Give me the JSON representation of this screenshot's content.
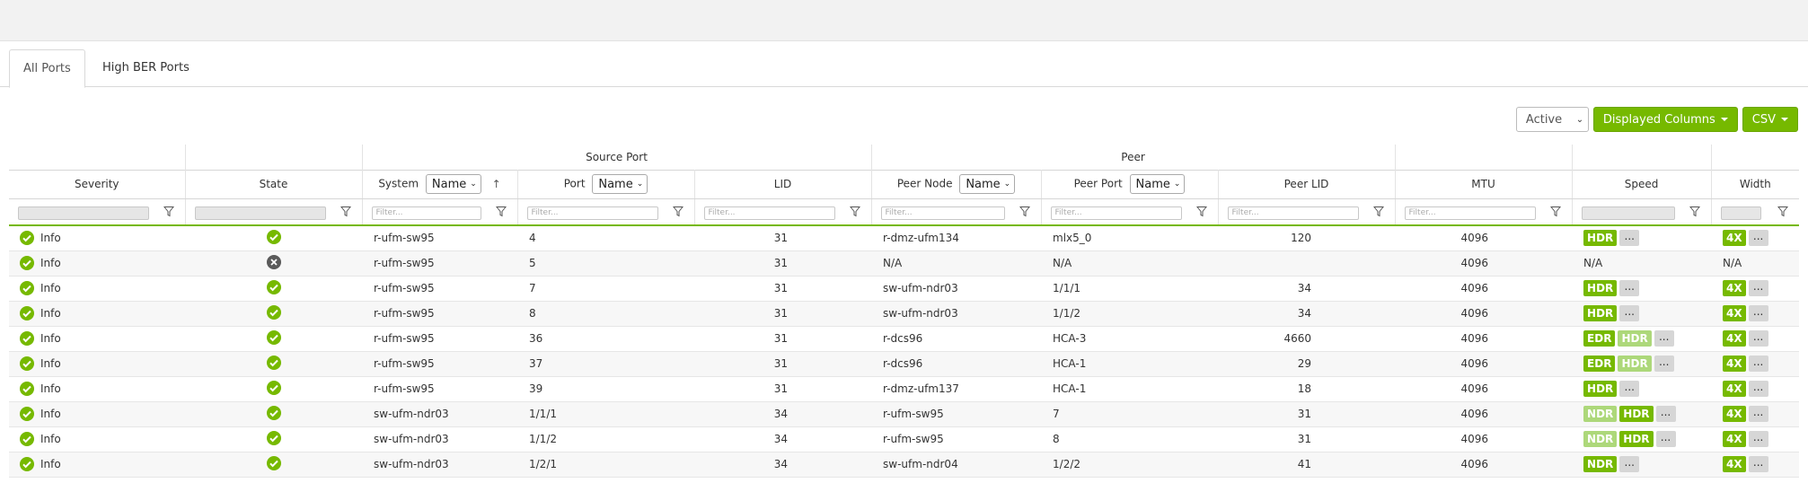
{
  "tabs": [
    {
      "label": "All Ports",
      "active": true
    },
    {
      "label": "High BER Ports",
      "active": false
    }
  ],
  "toolbar": {
    "state_select": "Active",
    "displayed_columns": "Displayed Columns",
    "csv": "CSV"
  },
  "groups": {
    "source_port": "Source Port",
    "peer": "Peer"
  },
  "columns": {
    "severity": "Severity",
    "state": "State",
    "system": "System",
    "system_select": "Name",
    "port": "Port",
    "port_select": "Name",
    "lid": "LID",
    "peer_node": "Peer Node",
    "peer_node_select": "Name",
    "peer_port": "Peer Port",
    "peer_port_select": "Name",
    "peer_lid": "Peer LID",
    "mtu": "MTU",
    "speed": "Speed",
    "width": "Width"
  },
  "filter_placeholder": "Filter...",
  "more_label": "...",
  "colors": {
    "accent": "#76b900",
    "accent_light": "#add87a",
    "state_error": "#5a5a5a"
  },
  "rows": [
    {
      "severity": "Info",
      "state": "ok",
      "system": "r-ufm-sw95",
      "port": "4",
      "lid": "31",
      "peer_node": "r-dmz-ufm134",
      "peer_port": "mlx5_0",
      "peer_lid": "120",
      "mtu": "4096",
      "speed": [
        {
          "label": "HDR",
          "tone": "dark"
        }
      ],
      "speed_more": true,
      "width": [
        {
          "label": "4X",
          "tone": "dark"
        }
      ],
      "width_more": true
    },
    {
      "severity": "Info",
      "state": "error",
      "system": "r-ufm-sw95",
      "port": "5",
      "lid": "31",
      "peer_node": "N/A",
      "peer_port": "N/A",
      "peer_lid": "",
      "mtu": "4096",
      "speed_text": "N/A",
      "width_text": "N/A"
    },
    {
      "severity": "Info",
      "state": "ok",
      "system": "r-ufm-sw95",
      "port": "7",
      "lid": "31",
      "peer_node": "sw-ufm-ndr03",
      "peer_port": "1/1/1",
      "peer_lid": "34",
      "mtu": "4096",
      "speed": [
        {
          "label": "HDR",
          "tone": "dark"
        }
      ],
      "speed_more": true,
      "width": [
        {
          "label": "4X",
          "tone": "dark"
        }
      ],
      "width_more": true
    },
    {
      "severity": "Info",
      "state": "ok",
      "system": "r-ufm-sw95",
      "port": "8",
      "lid": "31",
      "peer_node": "sw-ufm-ndr03",
      "peer_port": "1/1/2",
      "peer_lid": "34",
      "mtu": "4096",
      "speed": [
        {
          "label": "HDR",
          "tone": "dark"
        }
      ],
      "speed_more": true,
      "width": [
        {
          "label": "4X",
          "tone": "dark"
        }
      ],
      "width_more": true
    },
    {
      "severity": "Info",
      "state": "ok",
      "system": "r-ufm-sw95",
      "port": "36",
      "lid": "31",
      "peer_node": "r-dcs96",
      "peer_port": "HCA-3",
      "peer_lid": "4660",
      "mtu": "4096",
      "speed": [
        {
          "label": "EDR",
          "tone": "dark"
        },
        {
          "label": "HDR",
          "tone": "light"
        }
      ],
      "speed_more": true,
      "width": [
        {
          "label": "4X",
          "tone": "dark"
        }
      ],
      "width_more": true
    },
    {
      "severity": "Info",
      "state": "ok",
      "system": "r-ufm-sw95",
      "port": "37",
      "lid": "31",
      "peer_node": "r-dcs96",
      "peer_port": "HCA-1",
      "peer_lid": "29",
      "mtu": "4096",
      "speed": [
        {
          "label": "EDR",
          "tone": "dark"
        },
        {
          "label": "HDR",
          "tone": "light"
        }
      ],
      "speed_more": true,
      "width": [
        {
          "label": "4X",
          "tone": "dark"
        }
      ],
      "width_more": true
    },
    {
      "severity": "Info",
      "state": "ok",
      "system": "r-ufm-sw95",
      "port": "39",
      "lid": "31",
      "peer_node": "r-dmz-ufm137",
      "peer_port": "HCA-1",
      "peer_lid": "18",
      "mtu": "4096",
      "speed": [
        {
          "label": "HDR",
          "tone": "dark"
        }
      ],
      "speed_more": true,
      "width": [
        {
          "label": "4X",
          "tone": "dark"
        }
      ],
      "width_more": true
    },
    {
      "severity": "Info",
      "state": "ok",
      "system": "sw-ufm-ndr03",
      "port": "1/1/1",
      "lid": "34",
      "peer_node": "r-ufm-sw95",
      "peer_port": "7",
      "peer_lid": "31",
      "mtu": "4096",
      "speed": [
        {
          "label": "NDR",
          "tone": "light"
        },
        {
          "label": "HDR",
          "tone": "dark"
        }
      ],
      "speed_more": true,
      "width": [
        {
          "label": "4X",
          "tone": "dark"
        }
      ],
      "width_more": true
    },
    {
      "severity": "Info",
      "state": "ok",
      "system": "sw-ufm-ndr03",
      "port": "1/1/2",
      "lid": "34",
      "peer_node": "r-ufm-sw95",
      "peer_port": "8",
      "peer_lid": "31",
      "mtu": "4096",
      "speed": [
        {
          "label": "NDR",
          "tone": "light"
        },
        {
          "label": "HDR",
          "tone": "dark"
        }
      ],
      "speed_more": true,
      "width": [
        {
          "label": "4X",
          "tone": "dark"
        }
      ],
      "width_more": true
    },
    {
      "severity": "Info",
      "state": "ok",
      "system": "sw-ufm-ndr03",
      "port": "1/2/1",
      "lid": "34",
      "peer_node": "sw-ufm-ndr04",
      "peer_port": "1/2/2",
      "peer_lid": "41",
      "mtu": "4096",
      "speed": [
        {
          "label": "NDR",
          "tone": "dark"
        }
      ],
      "speed_more": true,
      "width": [
        {
          "label": "4X",
          "tone": "dark"
        }
      ],
      "width_more": true
    }
  ]
}
